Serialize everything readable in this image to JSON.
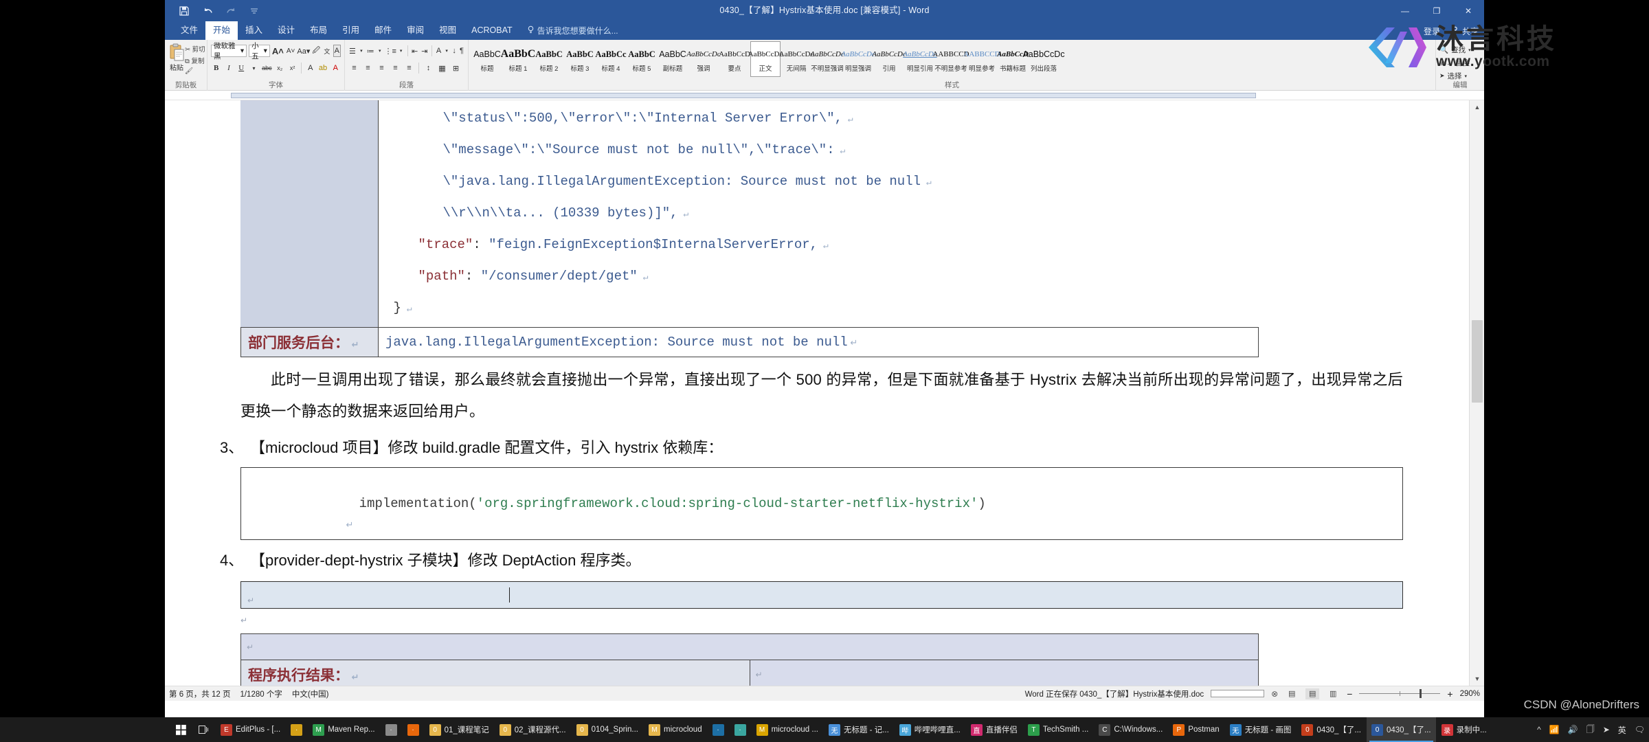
{
  "window": {
    "title": "0430_【了解】Hystrix基本使用.doc [兼容模式] - Word",
    "minimize": "—",
    "restore": "❐",
    "close": "✕",
    "quick_access": [
      "save-icon",
      "undo-icon",
      "redo-icon",
      "customize-icon"
    ]
  },
  "tabs": [
    {
      "label": "文件",
      "active": false
    },
    {
      "label": "开始",
      "active": true
    },
    {
      "label": "插入",
      "active": false
    },
    {
      "label": "设计",
      "active": false
    },
    {
      "label": "布局",
      "active": false
    },
    {
      "label": "引用",
      "active": false
    },
    {
      "label": "邮件",
      "active": false
    },
    {
      "label": "审阅",
      "active": false
    },
    {
      "label": "视图",
      "active": false
    },
    {
      "label": "ACROBAT",
      "active": false
    }
  ],
  "tell_me": "告诉我您想要做什么...",
  "account": {
    "signin": "登录",
    "share": "共享"
  },
  "ribbon": {
    "clipboard": {
      "group": "剪贴板",
      "paste": "粘贴",
      "cut": "剪切",
      "copy": "复制",
      "format_painter": "格式刷"
    },
    "font": {
      "group": "字体",
      "font_name": "微软雅黑",
      "font_size": "小五",
      "grow": "A",
      "shrink": "A",
      "change_case": "Aa",
      "clear_format": "清除所有格式",
      "phonetic": "拼音指南",
      "border": "字符边框",
      "bold": "B",
      "italic": "I",
      "underline": "U",
      "strikethrough": "abc",
      "subscript": "x₂",
      "superscript": "x²"
    },
    "paragraph": {
      "group": "段落",
      "bullets": "项目符号",
      "numbering": "编号",
      "multilevel": "多级列表",
      "decrease_indent": "减少缩进量",
      "increase_indent": "增加缩进量",
      "cn_layout": "中文版式",
      "sort": "排序",
      "show_marks": "显示编辑标记"
    },
    "styles": {
      "group": "样式",
      "items": [
        {
          "preview": "AaBbC",
          "name": "标题",
          "selected": false
        },
        {
          "preview": "AaBbC",
          "name": "标题 1",
          "selected": false
        },
        {
          "preview": "AaBbC",
          "name": "标题 2",
          "selected": false
        },
        {
          "preview": "AaBbC",
          "name": "标题 3",
          "selected": false
        },
        {
          "preview": "AaBbCc",
          "name": "标题 4",
          "selected": false
        },
        {
          "preview": "AaBbC",
          "name": "标题 5",
          "selected": false
        },
        {
          "preview": "AaBbC",
          "name": "副标题",
          "selected": false
        },
        {
          "preview": "AaBbCcDc",
          "name": "强调",
          "selected": false
        },
        {
          "preview": "AaBbCcD",
          "name": "要点",
          "selected": false
        },
        {
          "preview": "AaBbCcDc",
          "name": "正文",
          "selected": true
        },
        {
          "preview": "AaBbCcDc",
          "name": "无间隔",
          "selected": false
        },
        {
          "preview": "AaBbCcDc",
          "name": "不明显强调",
          "selected": false
        },
        {
          "preview": "AaBbCcDc",
          "name": "明显强调",
          "selected": false
        },
        {
          "preview": "AaBbCcDc",
          "name": "引用",
          "selected": false
        },
        {
          "preview": "AaBbCcDc",
          "name": "明显引用",
          "selected": false
        },
        {
          "preview": "AABBCCD",
          "name": "不明显参考",
          "selected": false
        },
        {
          "preview": "AABBCCD",
          "name": "明显参考",
          "selected": false
        },
        {
          "preview": "AaBbCcD",
          "name": "书籍标题",
          "selected": false
        },
        {
          "preview": "AaBbCcDc",
          "name": "列出段落",
          "selected": false
        }
      ]
    },
    "editing": {
      "group": "编辑",
      "find": "查找",
      "replace": "替换",
      "select": "选择"
    }
  },
  "document": {
    "code_block_top": {
      "lines": [
        {
          "indent": 7,
          "segments": [
            {
              "t": "\\\"status\\\":500,\\\"error\\\":\\\"Internal Server Error\\\",",
              "c": "v"
            }
          ]
        },
        {
          "indent": 7,
          "segments": [
            {
              "t": "\\\"message\\\":\\\"Source must not be null\\\",\\\"trace\\\":",
              "c": "v"
            }
          ]
        },
        {
          "indent": 7,
          "segments": [
            {
              "t": "\\\"java.lang.IllegalArgumentException: Source must not be null",
              "c": "v"
            }
          ]
        },
        {
          "indent": 7,
          "segments": [
            {
              "t": "\\\\r\\\\n\\\\ta... (10339 bytes)]\",",
              "c": "v"
            }
          ]
        },
        {
          "indent": 4,
          "segments": [
            {
              "t": "\"trace\"",
              "c": "k"
            },
            {
              "t": ": ",
              "c": "p"
            },
            {
              "t": "\"feign.FeignException$InternalServerError,",
              "c": "v"
            }
          ]
        },
        {
          "indent": 4,
          "segments": [
            {
              "t": "\"path\"",
              "c": "k"
            },
            {
              "t": ": ",
              "c": "p"
            },
            {
              "t": "\"/consumer/dept/get\"",
              "c": "v"
            }
          ]
        },
        {
          "indent": 1,
          "segments": [
            {
              "t": "}",
              "c": "p"
            }
          ]
        }
      ]
    },
    "backend_row": {
      "label": "部门服务后台：",
      "content": "java.lang.IllegalArgumentException: Source must not be null"
    },
    "paragraph_1": "此时一旦调用出现了错误，那么最终就会直接抛出一个异常，直接出现了一个 500 的异常，但是下面就准备基于 Hystrix 去解决当前所出现的异常问题了，出现异常之后更换一个静态的数据来返回给用户。",
    "step_3": {
      "num": "3、",
      "text": "【microcloud 项目】修改 build.gradle 配置文件，引入 hystrix 依赖库："
    },
    "step_3_code": {
      "call": "implementation(",
      "arg": "'org.springframework.cloud:spring-cloud-starter-netflix-hystrix'",
      "end": ")"
    },
    "step_4": {
      "num": "4、",
      "text": "【provider-dept-hystrix 子模块】修改 DeptAction 程序类。"
    },
    "result_row": {
      "label": "程序执行结果：",
      "content": ""
    }
  },
  "status": {
    "page": "第 6 页，共 12 页",
    "words": "1/1280 个字",
    "language": "中文(中国)",
    "saving": "Word 正在保存 0430_【了解】Hystrix基本使用.doc",
    "cancel_icon": "cancel-save-icon",
    "views": [
      {
        "name": "read-mode-view",
        "glyph": "▤",
        "active": false
      },
      {
        "name": "print-layout-view",
        "glyph": "▤",
        "active": true
      },
      {
        "name": "web-layout-view",
        "glyph": "▥",
        "active": false
      }
    ],
    "zoom_out": "−",
    "zoom_in": "+",
    "zoom_level": "290%"
  },
  "logo": {
    "cn": "沐言科技",
    "url": "www.yootk.com"
  },
  "watermark": "CSDN @AloneDrifters",
  "taskbar": {
    "start": "start-icon",
    "task_view": "task-view-icon",
    "items": [
      {
        "label": "EditPlus - [...",
        "icon": "editplus-icon",
        "color": "#c0392b",
        "active": false
      },
      {
        "label": "",
        "icon": "sublime-icon",
        "color": "#d4a017",
        "active": false
      },
      {
        "label": "Maven Rep...",
        "icon": "chrome-icon",
        "color": "#2e9e4f",
        "active": false
      },
      {
        "label": "",
        "icon": "app-icon",
        "color": "#8a8a8a",
        "active": false
      },
      {
        "label": "",
        "icon": "firefox-icon",
        "color": "#e8670c",
        "active": false
      },
      {
        "label": "01_课程笔记",
        "icon": "folder-icon",
        "color": "#e5b64c",
        "active": false
      },
      {
        "label": "02_课程源代...",
        "icon": "folder-icon",
        "color": "#e5b64c",
        "active": false
      },
      {
        "label": "0104_Sprin...",
        "icon": "folder-icon",
        "color": "#e5b64c",
        "active": false
      },
      {
        "label": "microcloud",
        "icon": "folder-icon",
        "color": "#e5b64c",
        "active": false
      },
      {
        "label": "",
        "icon": "photoshop-icon",
        "color": "#1d6fa5",
        "active": false
      },
      {
        "label": "",
        "icon": "app-icon",
        "color": "#3aa6a0",
        "active": false
      },
      {
        "label": "microcloud ...",
        "icon": "idea-icon",
        "color": "#d9a400",
        "active": false
      },
      {
        "label": "无标题 - 记...",
        "icon": "notepad-icon",
        "color": "#4a90d9",
        "active": false
      },
      {
        "label": "哔哩哔哩直...",
        "icon": "bilibili-icon",
        "color": "#4aa6d9",
        "active": false
      },
      {
        "label": "直播伴侣",
        "icon": "live-companion-icon",
        "color": "#d02a6e",
        "active": false
      },
      {
        "label": "TechSmith ...",
        "icon": "camtasia-icon",
        "color": "#2c9e4b",
        "active": false
      },
      {
        "label": "C:\\Windows...",
        "icon": "cmd-icon",
        "color": "#4a4a4a",
        "active": false
      },
      {
        "label": "Postman",
        "icon": "postman-icon",
        "color": "#e8670c",
        "active": false
      },
      {
        "label": "无标题 - 画图",
        "icon": "paint-icon",
        "color": "#2b7ec4",
        "active": false
      },
      {
        "label": "0430_【了...",
        "icon": "powerpoint-icon",
        "color": "#c43e1c",
        "active": false
      },
      {
        "label": "0430_【了...",
        "icon": "word-icon",
        "color": "#2b579a",
        "active": true
      },
      {
        "label": "录制中...",
        "icon": "recording-icon",
        "color": "#d13438",
        "active": false
      }
    ],
    "tray": [
      "show-hidden-icon",
      "network-icon",
      "volume-icon",
      "clipboard-icon",
      "send-icon",
      "ime-icon",
      "notification-icon"
    ]
  }
}
